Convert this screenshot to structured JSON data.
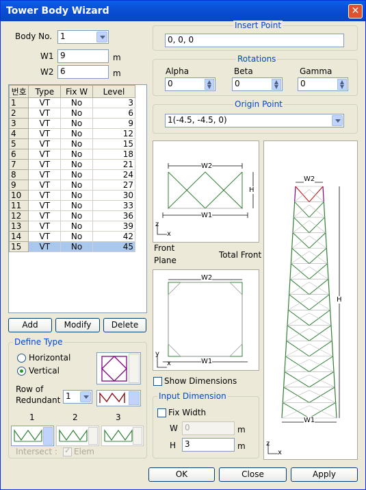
{
  "title": "Tower Body Wizard",
  "close_symbol": "✕",
  "body_no": {
    "label": "Body No.",
    "value": "1"
  },
  "w1": {
    "label": "W1",
    "value": "9",
    "unit": "m"
  },
  "w2": {
    "label": "W2",
    "value": "6",
    "unit": "m"
  },
  "table": {
    "headers": [
      "번호",
      "Type",
      "Fix W",
      "Level"
    ],
    "rows": [
      [
        "1",
        "VT",
        "No",
        "3"
      ],
      [
        "2",
        "VT",
        "No",
        "6"
      ],
      [
        "3",
        "VT",
        "No",
        "9"
      ],
      [
        "4",
        "VT",
        "No",
        "12"
      ],
      [
        "5",
        "VT",
        "No",
        "15"
      ],
      [
        "6",
        "VT",
        "No",
        "18"
      ],
      [
        "7",
        "VT",
        "No",
        "21"
      ],
      [
        "8",
        "VT",
        "No",
        "24"
      ],
      [
        "9",
        "VT",
        "No",
        "27"
      ],
      [
        "10",
        "VT",
        "No",
        "30"
      ],
      [
        "11",
        "VT",
        "No",
        "33"
      ],
      [
        "12",
        "VT",
        "No",
        "36"
      ],
      [
        "13",
        "VT",
        "No",
        "39"
      ],
      [
        "14",
        "VT",
        "No",
        "42"
      ],
      [
        "15",
        "VT",
        "No",
        "45"
      ]
    ],
    "selected_index": 14
  },
  "buttons": {
    "add": "Add",
    "modify": "Modify",
    "delete": "Delete",
    "ok": "OK",
    "close": "Close",
    "apply": "Apply"
  },
  "define_type": {
    "title": "Define Type",
    "horizontal": "Horizontal",
    "vertical": "Vertical",
    "row_of_redundant_1": "Row of",
    "row_of_redundant_2": "Redundant",
    "redundant_value": "1",
    "col1": "1",
    "col2": "2",
    "col3": "3",
    "intersect": "Intersect :",
    "elem": "Elem"
  },
  "insert_point": {
    "title": "Insert Point",
    "value": "0, 0, 0"
  },
  "rotations": {
    "title": "Rotations",
    "alpha": {
      "label": "Alpha",
      "value": "0"
    },
    "beta": {
      "label": "Beta",
      "value": "0"
    },
    "gamma": {
      "label": "Gamma",
      "value": "0"
    }
  },
  "origin_point": {
    "title": "Origin Point",
    "value": "1(-4.5, -4.5, 0)"
  },
  "front_view": {
    "w2": "W2",
    "w1": "W1",
    "h": "H",
    "z": "z",
    "x": "x"
  },
  "plane_view": {
    "w2": "W2",
    "w1": "W1",
    "y": "y",
    "x": "x"
  },
  "labels": {
    "front": "Front",
    "plane": "Plane",
    "total_front": "Total Front"
  },
  "total_view": {
    "w2": "W2",
    "w1": "W1",
    "h": "H",
    "z": "z",
    "x": "x"
  },
  "show_dimensions": "Show Dimensions",
  "input_dimension": {
    "title": "Input Dimension",
    "fix_width": "Fix Width",
    "w_label": "W",
    "w_value": "0",
    "w_unit": "m",
    "h_label": "H",
    "h_value": "3",
    "h_unit": "m"
  }
}
